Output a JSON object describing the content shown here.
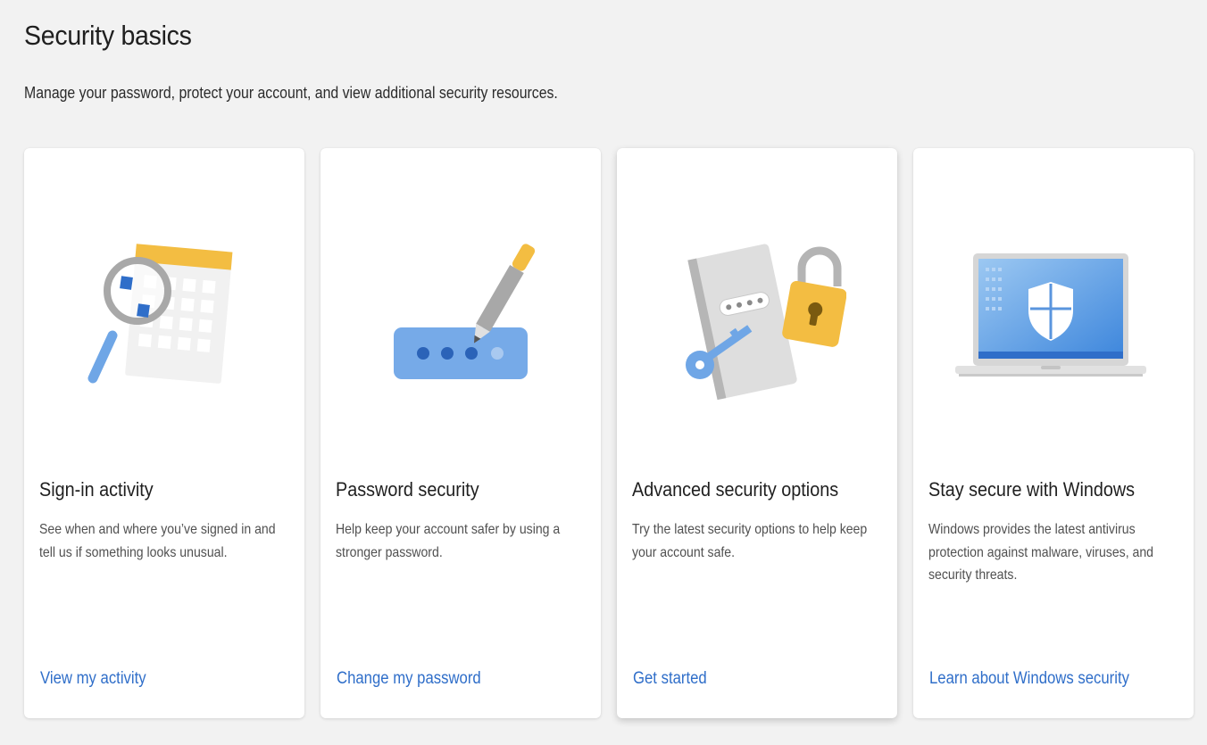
{
  "header": {
    "title": "Security basics",
    "subtitle": "Manage your password, protect your account, and view additional security resources."
  },
  "colors": {
    "background": "#f2f2f2",
    "card": "#ffffff",
    "link": "#2f6ec9",
    "accent_blue": "#6fa6e6",
    "accent_yellow": "#f3bd42"
  },
  "cards": [
    {
      "title": "Sign-in activity",
      "description": "See when and where you’ve signed in and tell us if something looks unusual.",
      "link": "View my activity",
      "icon": "calendar-magnifier-icon"
    },
    {
      "title": "Password security",
      "description": "Help keep your account safer by using a stronger password.",
      "link": "Change my password",
      "icon": "password-pen-icon"
    },
    {
      "title": "Advanced security options",
      "description": "Try the latest security options to help keep your account safe.",
      "link": "Get started",
      "icon": "lock-key-icon"
    },
    {
      "title": "Stay secure with Windows",
      "description": "Windows provides the latest antivirus protection against malware, viruses, and security threats.",
      "link": "Learn about Windows security",
      "icon": "laptop-shield-icon"
    }
  ]
}
